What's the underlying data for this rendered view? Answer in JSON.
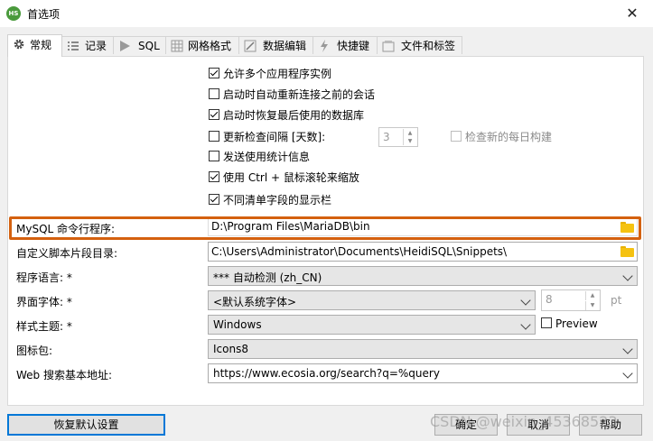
{
  "window": {
    "title": "首选项",
    "app_icon": "HS"
  },
  "tabs": [
    {
      "label": "常规",
      "icon": "gear-icon",
      "active": true
    },
    {
      "label": "记录",
      "icon": "log-icon"
    },
    {
      "label": "SQL",
      "icon": "play-icon"
    },
    {
      "label": "网格格式",
      "icon": "grid-icon"
    },
    {
      "label": "数据编辑",
      "icon": "edit-icon"
    },
    {
      "label": "快捷键",
      "icon": "lightning-icon"
    },
    {
      "label": "文件和标签",
      "icon": "file-tag-icon"
    }
  ],
  "checkboxes": [
    {
      "label": "允许多个应用程序实例",
      "checked": true
    },
    {
      "label": "启动时自动重新连接之前的会话",
      "checked": false
    },
    {
      "label": "启动时恢复最后使用的数据库",
      "checked": true
    },
    {
      "label": "更新检查间隔 [天数]:",
      "checked": false
    },
    {
      "label": "发送使用统计信息",
      "checked": false
    },
    {
      "label": "使用 Ctrl + 鼠标滚轮来缩放",
      "checked": true
    },
    {
      "label": "不同清单字段的显示栏",
      "checked": true
    }
  ],
  "update_interval": {
    "value": "3"
  },
  "nightly_check": {
    "label": "检查新的每日构建",
    "checked": false
  },
  "fields": {
    "mysql_cmd": {
      "label": "MySQL 命令行程序:",
      "value": "D:\\Program Files\\MariaDB\\bin"
    },
    "snippets": {
      "label": "自定义脚本片段目录:",
      "value": "C:\\Users\\Administrator\\Documents\\HeidiSQL\\Snippets\\"
    },
    "language": {
      "label": "程序语言: *",
      "value": "*** 自动检测 (zh_CN)"
    },
    "font": {
      "label": "界面字体: *",
      "value": "<默认系统字体>",
      "size": "8",
      "unit": "pt"
    },
    "theme": {
      "label": "样式主题: *",
      "value": "Windows",
      "preview_label": "Preview"
    },
    "iconpack": {
      "label": "图标包:",
      "value": "Icons8"
    },
    "websearch": {
      "label": "Web 搜索基本地址:",
      "value": "https://www.ecosia.org/search?q=%query"
    }
  },
  "buttons": {
    "restore": "恢复默认设置",
    "ok": "确定",
    "cancel": "取消",
    "help": "帮助"
  },
  "watermark": "CSDN @weixin_45368523",
  "colors": {
    "highlight": "#d4610f",
    "folder": "#f5c211",
    "default_button": "#0078d7"
  }
}
